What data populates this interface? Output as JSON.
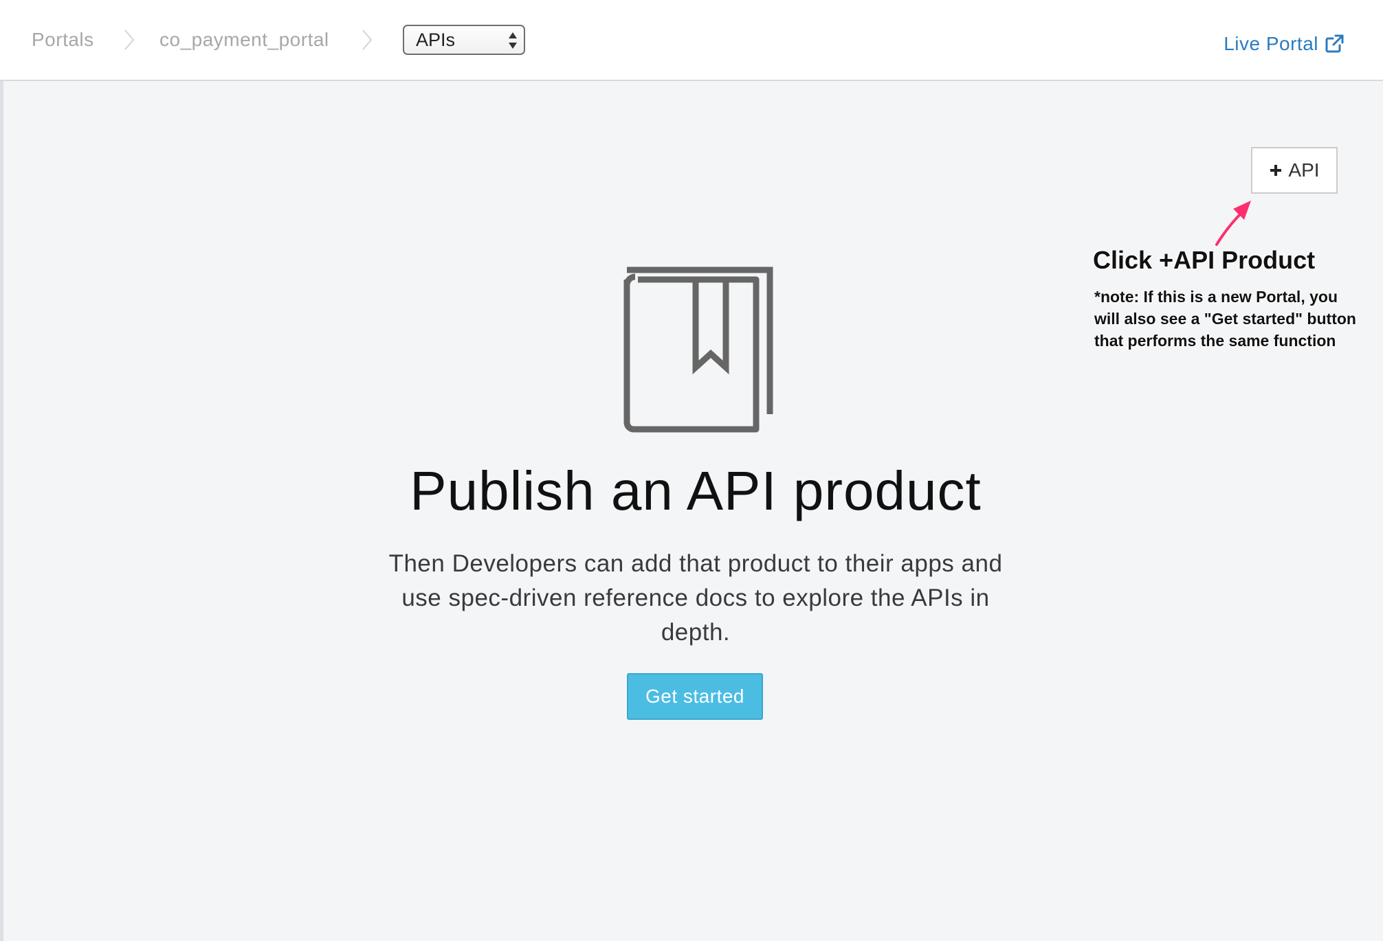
{
  "header": {
    "breadcrumb": {
      "portals_label": "Portals",
      "portal_name": "co_payment_portal"
    },
    "section_select": {
      "selected": "APIs"
    },
    "live_portal_label": "Live Portal",
    "icons": {
      "breadcrumb_separator": "chevron-right-icon",
      "select_arrows": "sort-arrows-icon",
      "live_portal": "external-link-icon"
    }
  },
  "main": {
    "add_api_button": {
      "icon": "plus-icon",
      "label": "API"
    },
    "annotation": {
      "title": "Click +API Product",
      "note": "*note: If this is a new Portal, you will also see  a \"Get started\" button that performs the same function",
      "arrow_color": "#ff2e6e"
    },
    "empty_state": {
      "icon": "book-bookmark-icon",
      "title": "Publish an API product",
      "description": "Then Developers can add that product to their apps and use spec-driven reference docs to explore the APIs in depth.",
      "button_label": "Get started"
    }
  },
  "colors": {
    "link": "#2b7bbf",
    "primary_button": "#4bbde3",
    "content_background": "#f4f5f7",
    "icon_gray": "#666666"
  }
}
